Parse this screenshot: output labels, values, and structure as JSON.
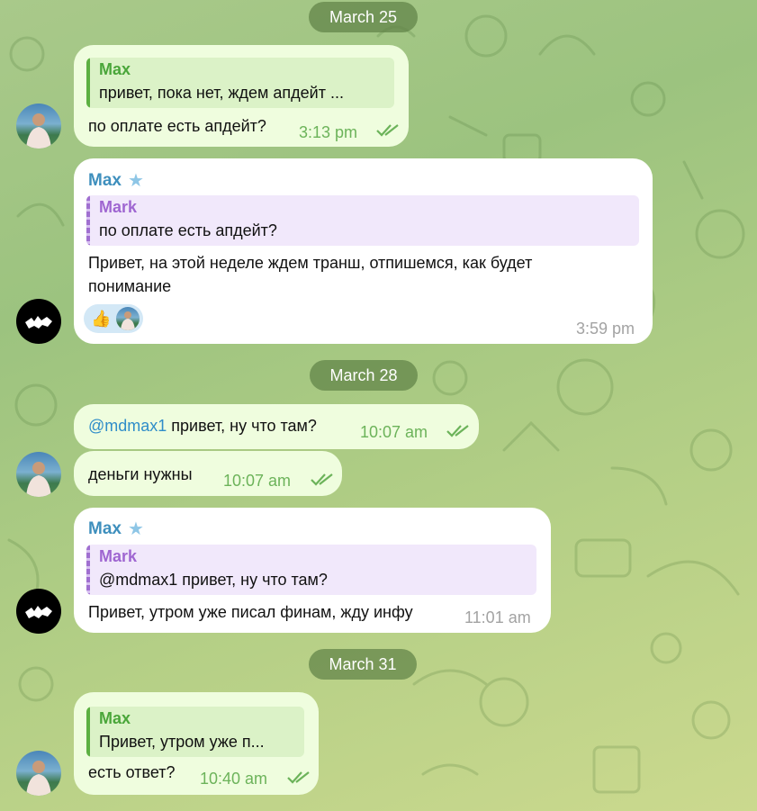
{
  "colors": {
    "outgoing_bubble": "#effdde",
    "incoming_bubble": "#ffffff",
    "date_pill": "#5f8246",
    "sender_name": "#3e8fbd",
    "quote_green": "#4aa63a",
    "quote_purple": "#9f66d1",
    "time_out": "#6cb35a",
    "time_in": "#a3a3a3"
  },
  "dates": {
    "d1": "March 25",
    "d2": "March 28",
    "d3": "March 31"
  },
  "messages": [
    {
      "direction": "out",
      "quote_author": "Max",
      "quote_text": "привет, пока нет, ждем апдейт ...",
      "text": "по оплате есть апдейт?",
      "time": "3:13 pm",
      "status_icon": "double-check-icon"
    },
    {
      "direction": "in",
      "sender": "Max",
      "sender_badge": "star-icon",
      "quote_author": "Mark",
      "quote_text": "по оплате есть апдейт?",
      "text_line1": "Привет, на этой неделе ждем транш, отпишемся, как будет",
      "text_line2": "понимание",
      "reaction_emoji": "👍",
      "time": "3:59 pm"
    },
    {
      "direction": "out",
      "mention": "@mdmax1",
      "text": " привет, ну что там?",
      "time": "10:07 am",
      "status_icon": "double-check-icon"
    },
    {
      "direction": "out",
      "text": "деньги нужны",
      "time": "10:07 am",
      "status_icon": "double-check-icon"
    },
    {
      "direction": "in",
      "sender": "Max",
      "sender_badge": "star-icon",
      "quote_author": "Mark",
      "quote_text": "@mdmax1 привет, ну что там?",
      "text": "Привет, утром уже писал финам, жду инфу",
      "time": "11:01 am"
    },
    {
      "direction": "out",
      "quote_author": "Max",
      "quote_text": "Привет, утром уже п...",
      "text": "есть ответ?",
      "time": "10:40 am",
      "status_icon": "double-check-icon"
    }
  ]
}
